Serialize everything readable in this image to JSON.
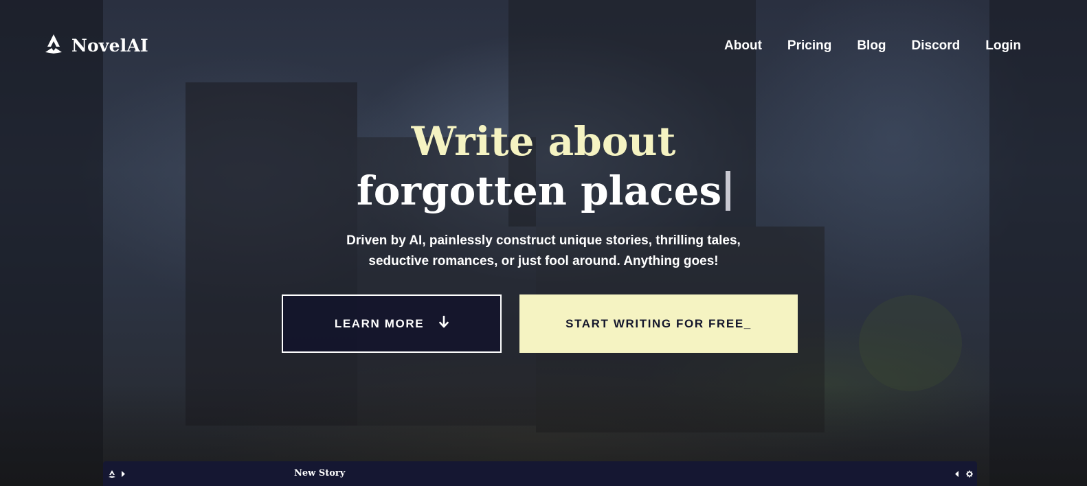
{
  "brand": {
    "name": "NovelAI",
    "logo_icon": "novelai-quill-icon"
  },
  "nav": {
    "links": [
      {
        "label": "About"
      },
      {
        "label": "Pricing"
      },
      {
        "label": "Blog"
      },
      {
        "label": "Discord"
      },
      {
        "label": "Login"
      }
    ]
  },
  "hero": {
    "headline_line1": "Write about",
    "headline_line2": "forgotten places",
    "subtitle_line1": "Driven by AI, painlessly construct unique stories, thrilling tales,",
    "subtitle_line2": "seductive romances, or just fool around. Anything goes!"
  },
  "buttons": {
    "learn_more": "LEARN MORE",
    "learn_more_icon": "arrow-down-icon",
    "start_writing": "START WRITING FOR FREE_"
  },
  "preview": {
    "title": "New Story",
    "left_icons": [
      "novelai-logo-icon",
      "chevron-right-icon"
    ],
    "right_icons": [
      "chevron-left-icon",
      "gear-icon"
    ]
  },
  "colors": {
    "accent_cream": "#f5f3c2",
    "dark_navy": "#13152b",
    "white": "#ffffff"
  }
}
